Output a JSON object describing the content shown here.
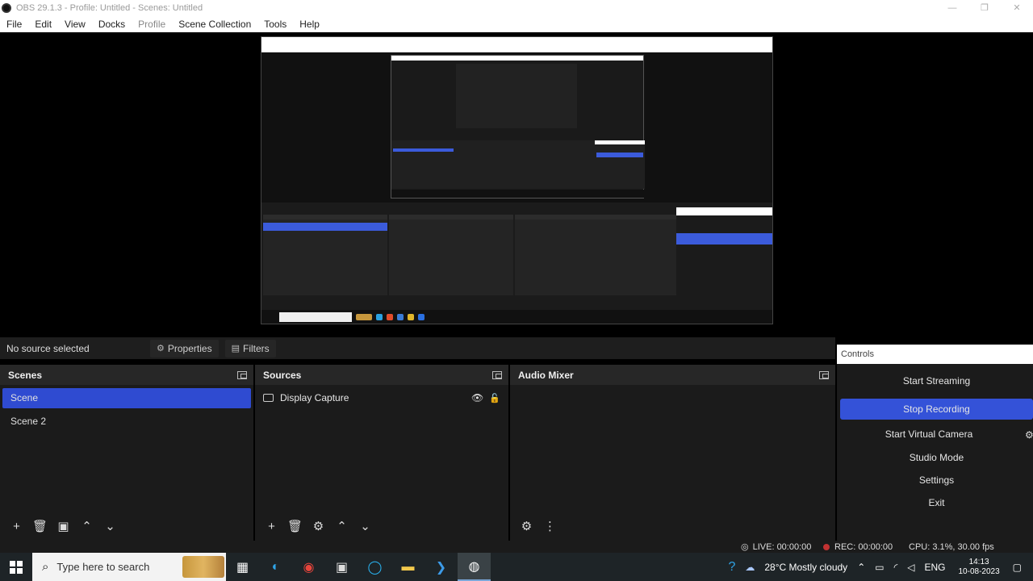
{
  "window": {
    "title": "OBS 29.1.3 - Profile: Untitled - Scenes: Untitled",
    "minimize": "—",
    "maximize": "❐",
    "close": "✕"
  },
  "menu": {
    "items": [
      "File",
      "Edit",
      "View",
      "Docks",
      "Profile",
      "Scene Collection",
      "Tools",
      "Help"
    ]
  },
  "source_toolbar": {
    "status": "No source selected",
    "properties_label": "Properties",
    "filters_label": "Filters"
  },
  "scenes": {
    "title": "Scenes",
    "items": [
      "Scene",
      "Scene 2"
    ],
    "selected": "Scene"
  },
  "sources": {
    "title": "Sources",
    "items": [
      {
        "name": "Display Capture",
        "visible": true,
        "locked": false
      }
    ]
  },
  "audio_mixer": {
    "title": "Audio Mixer"
  },
  "controls": {
    "title": "Controls",
    "buttons": [
      "Start Streaming",
      "Stop Recording",
      "Start Virtual Camera",
      "Studio Mode",
      "Settings",
      "Exit"
    ],
    "active": "Stop Recording"
  },
  "status": {
    "live": "LIVE: 00:00:00",
    "rec": "REC: 00:00:00",
    "cpu": "CPU: 3.1%, 30.00 fps"
  },
  "taskbar": {
    "search_placeholder": "Type here to search",
    "weather": "28°C  Mostly cloudy",
    "language": "ENG",
    "time": "14:13",
    "date": "10-08-2023"
  },
  "colors": {
    "accent": "#3452d8",
    "rec_dot": "#c23232",
    "dock_bg": "#1b1b1b"
  }
}
